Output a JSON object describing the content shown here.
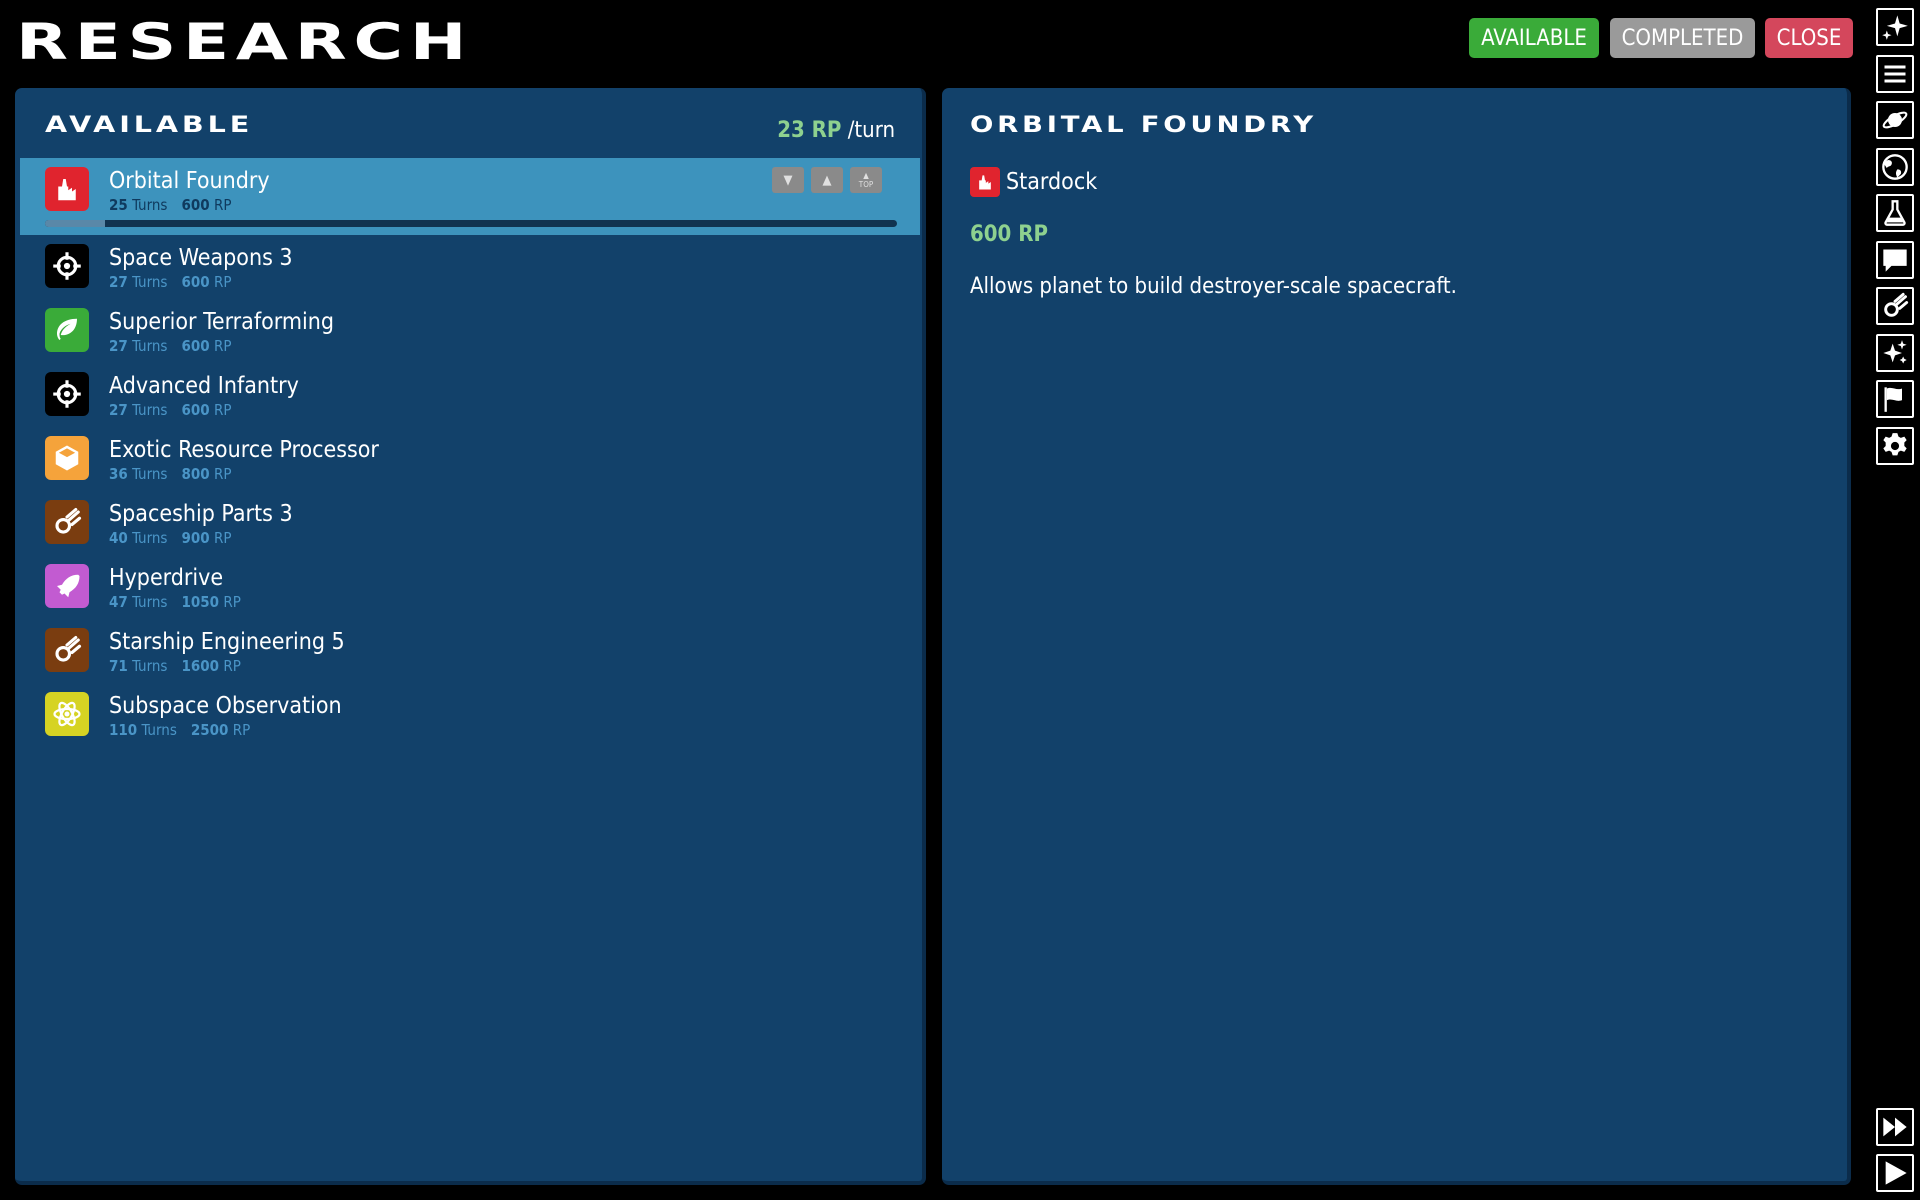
{
  "header": {
    "title": "RESEARCH",
    "buttons": {
      "available": "AVAILABLE",
      "completed": "COMPLETED",
      "close": "CLOSE"
    }
  },
  "left_panel": {
    "heading": "Available",
    "rp_rate_value": "23 RP",
    "rp_rate_unit": "/turn",
    "queue_buttons": {
      "down": "▼",
      "up": "▲",
      "top": "TOP"
    },
    "items": [
      {
        "name": "Orbital Foundry",
        "turns": "25",
        "cost": "600",
        "icon": "factory-icon",
        "color": "#e0242e",
        "progress": 0.07
      },
      {
        "name": "Space Weapons 3",
        "turns": "27",
        "cost": "600",
        "icon": "crosshair-icon",
        "color": "#000000"
      },
      {
        "name": "Superior Terraforming",
        "turns": "27",
        "cost": "600",
        "icon": "leaf-icon",
        "color": "#3aab39"
      },
      {
        "name": "Advanced Infantry",
        "turns": "27",
        "cost": "600",
        "icon": "crosshair-icon",
        "color": "#000000"
      },
      {
        "name": "Exotic Resource Processor",
        "turns": "36",
        "cost": "800",
        "icon": "cube-icon",
        "color": "#f5a33b"
      },
      {
        "name": "Spaceship Parts 3",
        "turns": "40",
        "cost": "900",
        "icon": "comet-icon",
        "color": "#7a3d10"
      },
      {
        "name": "Hyperdrive",
        "turns": "47",
        "cost": "1050",
        "icon": "rocket-icon",
        "color": "#c25bd1"
      },
      {
        "name": "Starship Engineering 5",
        "turns": "71",
        "cost": "1600",
        "icon": "comet-icon",
        "color": "#7a3d10"
      },
      {
        "name": "Subspace Observation",
        "turns": "110",
        "cost": "2500",
        "icon": "atom-icon",
        "color": "#d6d323"
      }
    ],
    "labels": {
      "turns": "Turns",
      "rp": "RP"
    }
  },
  "detail": {
    "title": "Orbital Foundry",
    "unlock_icon": "factory-icon",
    "unlock": "Stardock",
    "cost": "600 RP",
    "description": "Allows planet to build destroyer-scale spacecraft."
  },
  "sidebar_icons": [
    "sparkle-icon",
    "menu-icon",
    "planet-icon",
    "globe-icon",
    "flask-icon",
    "chat-icon",
    "comet-icon",
    "stars-icon",
    "flag-icon",
    "gear-icon"
  ],
  "bottom_icons": [
    "fast-forward-icon",
    "play-icon"
  ]
}
